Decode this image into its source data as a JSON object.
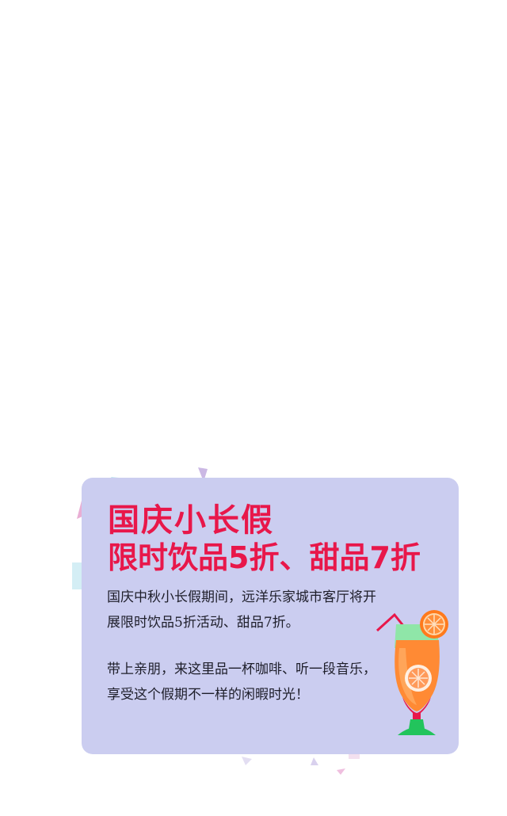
{
  "promo": {
    "headline_1": "国庆小长假",
    "headline_2": "限时饮品5折、甜品7折",
    "paragraph_1": "国庆中秋小长假期间，远洋乐家城市客厅将开展限时饮品5折活动、甜品7折。",
    "paragraph_2": "带上亲朋，来这里品一杯咖啡、听一段音乐，享受这个假期不一样的闲暇时光！"
  },
  "colors": {
    "card_bg": "#cbcdf0",
    "headline": "#e8174a",
    "body_text": "#1e1e2a"
  },
  "icons": [
    "cocktail-glass-icon",
    "orange-slice-icon",
    "confetti-triangle-icon"
  ]
}
